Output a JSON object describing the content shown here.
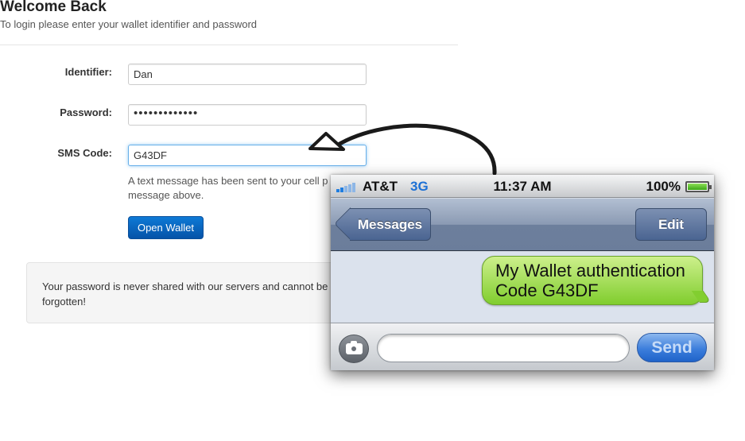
{
  "login": {
    "title": "Welcome Back",
    "subtitle": "To login please enter your wallet identifier and password",
    "identifier_label": "Identifier:",
    "identifier_value": "Dan",
    "password_label": "Password:",
    "password_value": "•••••••••••••",
    "sms_label": "SMS Code:",
    "sms_value": "G43DF",
    "sms_help": "A text message has been sent to your cell p code in that message above.",
    "open_button": "Open Wallet",
    "note": "Your password is never shared with our servers and cannot be forgotten!"
  },
  "phone": {
    "carrier": "AT&T",
    "network": "3G",
    "time": "11:37 AM",
    "battery_text": "100%",
    "battery_level": 1.0,
    "back_label": "Messages",
    "edit_label": "Edit",
    "message_text": "My Wallet authentication Code G43DF",
    "send_label": "Send",
    "icons": {
      "signal": "signal-bars-icon",
      "battery": "battery-icon",
      "camera": "camera-icon"
    }
  },
  "colors": {
    "primary_button": "#0553a8",
    "bubble_green": "#80cd2e",
    "focus_blue": "#66afe9",
    "network_blue": "#1d71d5"
  }
}
